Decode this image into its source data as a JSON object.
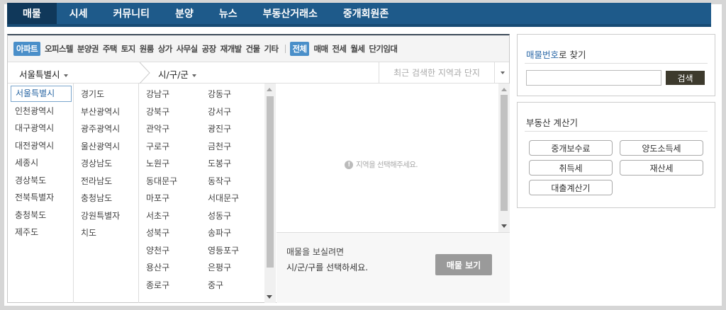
{
  "nav": {
    "items": [
      {
        "label": "매물",
        "active": true
      },
      {
        "label": "시세"
      },
      {
        "label": "커뮤니티"
      },
      {
        "label": "분양"
      },
      {
        "label": "뉴스"
      },
      {
        "label": "부동산거래소"
      },
      {
        "label": "중개회원존"
      }
    ]
  },
  "filters": {
    "types": [
      "아파트",
      "오피스텔",
      "분양권",
      "주택",
      "토지",
      "원룸",
      "상가",
      "사무실",
      "공장",
      "재개발",
      "건물",
      "기타"
    ],
    "deals": [
      "전체",
      "매매",
      "전세",
      "월세",
      "단기임대"
    ]
  },
  "location": {
    "sido_selected": "서울특별시",
    "sigungu_placeholder": "시/구/군",
    "recent_label": "최근 검색한 지역과 단지"
  },
  "sido_list": [
    "서울특별시",
    "인천광역시",
    "대구광역시",
    "대전광역시",
    "세종시",
    "경상북도",
    "전북특별자",
    "충청북도",
    "제주도",
    "경기도",
    "부산광역시",
    "광주광역시",
    "울산광역시",
    "경상남도",
    "전라남도",
    "충청남도",
    "강원특별자",
    "치도"
  ],
  "gu_list": [
    "강남구",
    "강북구",
    "관악구",
    "구로구",
    "노원구",
    "동대문구",
    "마포구",
    "서초구",
    "성북구",
    "양천구",
    "용산구",
    "종로구",
    "강동구",
    "강서구",
    "광진구",
    "금천구",
    "도봉구",
    "동작구",
    "서대문구",
    "성동구",
    "송파구",
    "영등포구",
    "은평구",
    "중구"
  ],
  "dong_notice": "지역을 선택해주세요.",
  "view": {
    "line1": "매물을 보실려면",
    "line2": "시/군/구를 선택하세요.",
    "button": "매물 보기"
  },
  "listing_search": {
    "title_accent": "매물번호",
    "title_rest": "로 찾기",
    "input_value": "",
    "button": "검색"
  },
  "calculator": {
    "title": "부동산 계산기",
    "buttons": [
      "중개보수료",
      "양도소득세",
      "취득세",
      "재산세",
      "대출계산기"
    ]
  }
}
